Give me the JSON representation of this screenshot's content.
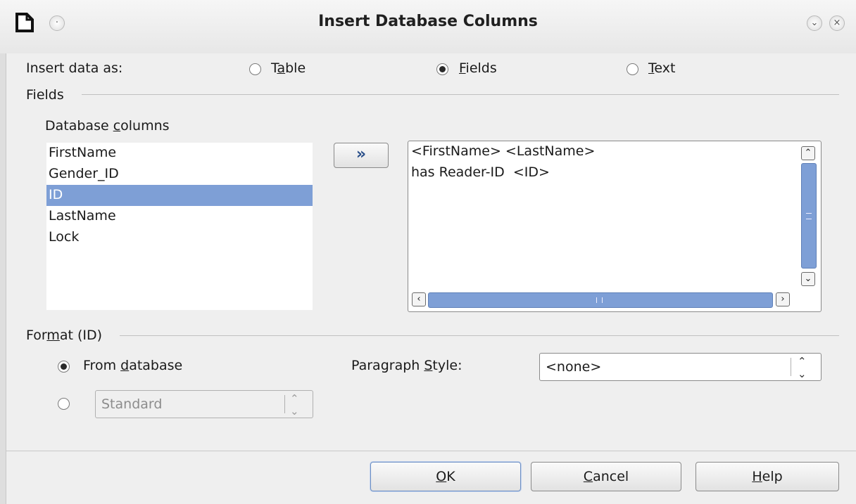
{
  "window": {
    "title": "Insert Database Columns"
  },
  "insert_as": {
    "label": "Insert data as:",
    "options": [
      {
        "pre": "T",
        "key": "a",
        "post": "ble",
        "checked": false
      },
      {
        "pre": "",
        "key": "F",
        "post": "ields",
        "checked": true
      },
      {
        "pre": "",
        "key": "T",
        "post": "ext",
        "checked": false
      }
    ]
  },
  "fields_section": {
    "title": "Fields",
    "db_columns_label": {
      "pre": "Database ",
      "key": "c",
      "post": "olumns"
    },
    "columns": [
      "FirstName",
      "Gender_ID",
      "ID",
      "LastName",
      "Lock"
    ],
    "selected_column": "ID",
    "add_button": "»",
    "field_lines": [
      "<FirstName> <LastName>",
      "has Reader-ID  <ID>"
    ]
  },
  "format_section": {
    "title": {
      "pre": "For",
      "key": "m",
      "post": "at (ID)"
    },
    "from_database": {
      "pre": "From ",
      "key": "d",
      "post": "atabase",
      "checked": true
    },
    "custom_format": {
      "checked": false,
      "value": "Standard"
    },
    "paragraph_style_label": {
      "pre": "Paragraph ",
      "key": "S",
      "post": "tyle:"
    },
    "paragraph_style_value": "<none>"
  },
  "buttons": {
    "ok": {
      "key": "O",
      "post": "K"
    },
    "cancel": {
      "key": "C",
      "post": "ancel"
    },
    "help": {
      "key": "H",
      "post": "elp"
    }
  }
}
